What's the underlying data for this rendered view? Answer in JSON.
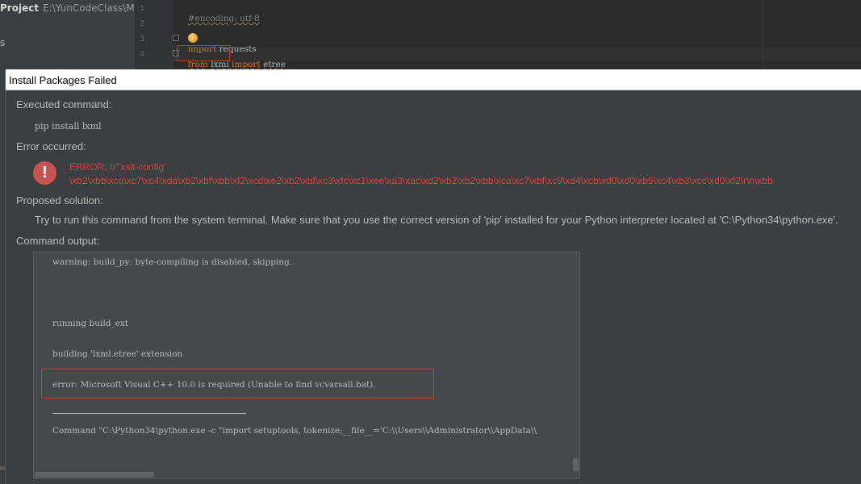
{
  "ide": {
    "project_label": "Project",
    "project_path": "E:\\YunCodeClass\\Mul",
    "side_letter": "s",
    "line_numbers": [
      "1",
      "2",
      "3",
      "4"
    ],
    "code": {
      "line1": "#encoding: utf-8",
      "line3_kw": "import",
      "line3_rest": " requests",
      "line4_kw": "from",
      "line4_mod": " lxml ",
      "line4_kw2": "import",
      "line4_rest": " etree"
    }
  },
  "dialog": {
    "title": "Install Packages Failed",
    "executed_label": "Executed command:",
    "command": "pip install lxml",
    "error_occurred_label": "Error occurred:",
    "error_line1": "ERROR: b\"'xslt-config'",
    "error_line2": "\\xb2\\xbb\\xca\\xc7\\xc4\\xda\\xb2\\xbf\\xbb\\xf2\\xcd\\xe2\\xb2\\xbf\\xc3\\xfc\\xc1\\xee\\xa3\\xac\\xd2\\xb2\\xb2\\xbb\\xca\\xc7\\xbf\\xc9\\xd4\\xcb\\xd0\\xd0\\xb5\\xc4\\xb3\\xcc\\xd0\\xf2\\r\\n\\xbb",
    "proposed_label": "Proposed solution:",
    "solution": "Try to run this command from the system terminal. Make sure that you use the correct version of 'pip' installed for your Python interpreter located at 'C:\\Python34\\python.exe'.",
    "output_label": "Command output:",
    "output_lines": {
      "warning": "warning: build_py: byte-compiling is disabled, skipping.",
      "running": "running build_ext",
      "building": "building 'lxml.etree' extension",
      "error": "error: Microsoft Visual C++ 10.0 is required (Unable to find vcvarsall.bat).",
      "command": "Command \"C:\\Python34\\python.exe -c \"import setuptools, tokenize;__file__='C:\\\\Users\\\\Administrator\\\\AppData\\\\"
    }
  },
  "colors": {
    "error_red": "#e03c3c",
    "dialog_bg": "#3c3f41",
    "output_bg": "#45494a"
  }
}
